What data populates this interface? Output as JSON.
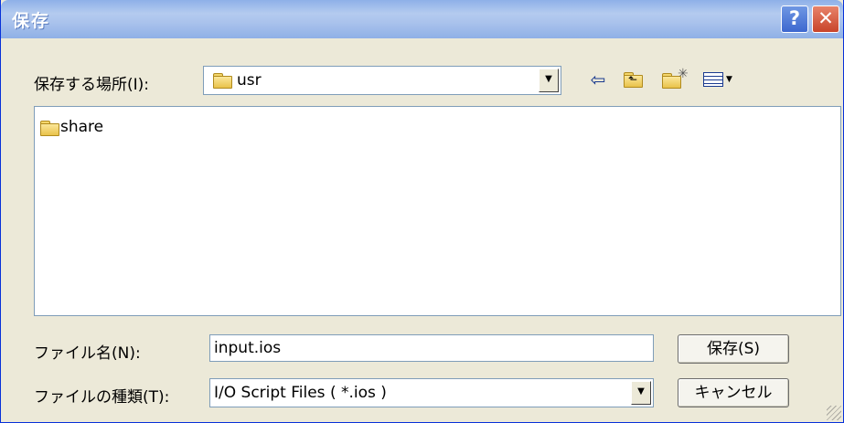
{
  "window": {
    "title": "保存"
  },
  "save_in": {
    "label": "保存する場所(I):",
    "value": "usr"
  },
  "toolbar": {
    "back_icon": "back-arrow-icon",
    "up_icon": "up-folder-icon",
    "new_folder_icon": "new-folder-icon",
    "view_menu_icon": "view-menu-icon"
  },
  "files": [
    {
      "name": "share",
      "icon": "folder-icon"
    }
  ],
  "filename": {
    "label": "ファイル名(N):",
    "value": "input.ios"
  },
  "filetype": {
    "label": "ファイルの種類(T):",
    "value": "I/O Script Files ( *.ios )"
  },
  "buttons": {
    "save": "保存(S)",
    "cancel": "キャンセル"
  },
  "colors": {
    "window_bg": "#ece9d8",
    "titlebar": "#8eb0e8",
    "close": "#c8442a",
    "help": "#3d68cf"
  }
}
